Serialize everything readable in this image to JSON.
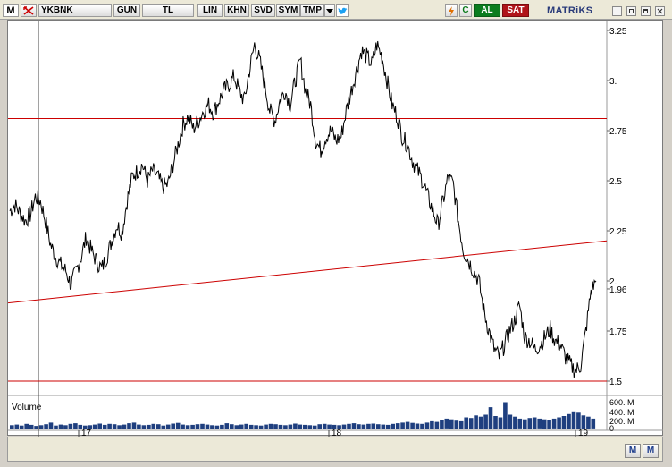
{
  "toolbar": {
    "logo": "M",
    "symbol": "YKBNK",
    "buttons": [
      "GUN",
      "TL",
      "LIN",
      "KHN",
      "SVD",
      "SYM",
      "TMP"
    ],
    "buy": "AL",
    "sell": "SAT",
    "brand": "MATRiKS",
    "refresh_glyph": "C"
  },
  "colors": {
    "price": "#000000",
    "hlines": "#cc0000",
    "trendline": "#cc0000",
    "volume": "#1f3f7f",
    "buy_button": "#0b7d1f",
    "sell_button": "#b0141a"
  },
  "volume_panel": {
    "title": "Volume",
    "tick_labels": [
      "600. M",
      "400. M",
      "200. M",
      "0"
    ]
  },
  "x_axis": {
    "tick_labels": [
      "17",
      "18",
      "19"
    ]
  },
  "bottom_bar": {
    "buttons": [
      "M",
      "M"
    ]
  },
  "chart_data": {
    "type": "line",
    "xlabel": "",
    "ylabel": "",
    "y_ticks": [
      3.25,
      3.0,
      2.75,
      2.5,
      2.25,
      2.0,
      1.96,
      1.75,
      1.5
    ],
    "y_tick_labels": [
      "3.25",
      "3.",
      "2.75",
      "2.5",
      "2.25",
      "2.",
      "1.96",
      "1.75",
      "1.5"
    ],
    "ylim": [
      1.5,
      3.27
    ],
    "x_period_labels": [
      "17",
      "18",
      "19"
    ],
    "horizontal_lines": [
      2.81,
      1.94,
      1.5
    ],
    "trendline": {
      "from": 1.89,
      "to": 2.2
    },
    "series": [
      {
        "values": [
          2.35,
          2.38,
          2.34,
          2.3,
          2.33,
          2.42,
          2.4,
          2.3,
          2.18,
          2.12,
          2.08,
          2.05,
          1.98,
          2.05,
          2.12,
          2.22,
          2.15,
          2.1,
          2.06,
          2.12,
          2.2,
          2.28,
          2.24,
          2.4,
          2.52,
          2.55,
          2.58,
          2.5,
          2.55,
          2.52,
          2.47,
          2.48,
          2.58,
          2.68,
          2.78,
          2.82,
          2.76,
          2.8,
          2.85,
          2.88,
          2.84,
          2.9,
          2.95,
          2.98,
          3.02,
          2.95,
          2.9,
          3.05,
          3.18,
          3.1,
          2.98,
          2.85,
          2.8,
          2.9,
          2.95,
          2.88,
          3.0,
          3.1,
          2.95,
          2.88,
          2.7,
          2.65,
          2.72,
          2.75,
          2.7,
          2.72,
          2.85,
          2.95,
          3.05,
          3.15,
          3.12,
          3.08,
          3.18,
          3.12,
          3.0,
          2.88,
          2.82,
          2.72,
          2.68,
          2.6,
          2.55,
          2.5,
          2.42,
          2.35,
          2.28,
          2.4,
          2.52,
          2.48,
          2.3,
          2.15,
          2.1,
          2.05,
          2.0,
          1.85,
          1.75,
          1.66,
          1.62,
          1.68,
          1.75,
          1.8,
          1.88,
          1.72,
          1.7,
          1.66,
          1.68,
          1.72,
          1.76,
          1.7,
          1.68,
          1.62,
          1.58,
          1.55,
          1.58,
          1.75,
          1.95,
          2.0
        ]
      }
    ],
    "volume_values": [
      10,
      12,
      9,
      14,
      11,
      8,
      10,
      13,
      18,
      9,
      12,
      10,
      14,
      16,
      11,
      9,
      10,
      12,
      15,
      11,
      14,
      13,
      10,
      12,
      16,
      18,
      12,
      10,
      11,
      14,
      13,
      9,
      12,
      15,
      17,
      12,
      10,
      11,
      13,
      14,
      12,
      10,
      9,
      11,
      16,
      13,
      10,
      12,
      14,
      11,
      10,
      9,
      12,
      14,
      13,
      11,
      10,
      12,
      15,
      12,
      11,
      10,
      9,
      13,
      14,
      12,
      11,
      10,
      12,
      14,
      16,
      13,
      12,
      14,
      15,
      13,
      12,
      11,
      14,
      16,
      18,
      20,
      17,
      15,
      14,
      18,
      22,
      20,
      26,
      30,
      28,
      24,
      22,
      34,
      32,
      40,
      36,
      42,
      65,
      38,
      34,
      80,
      42,
      36,
      30,
      28,
      32,
      34,
      30,
      28,
      26,
      30,
      34,
      38,
      44,
      52,
      48,
      40,
      36,
      30
    ]
  }
}
